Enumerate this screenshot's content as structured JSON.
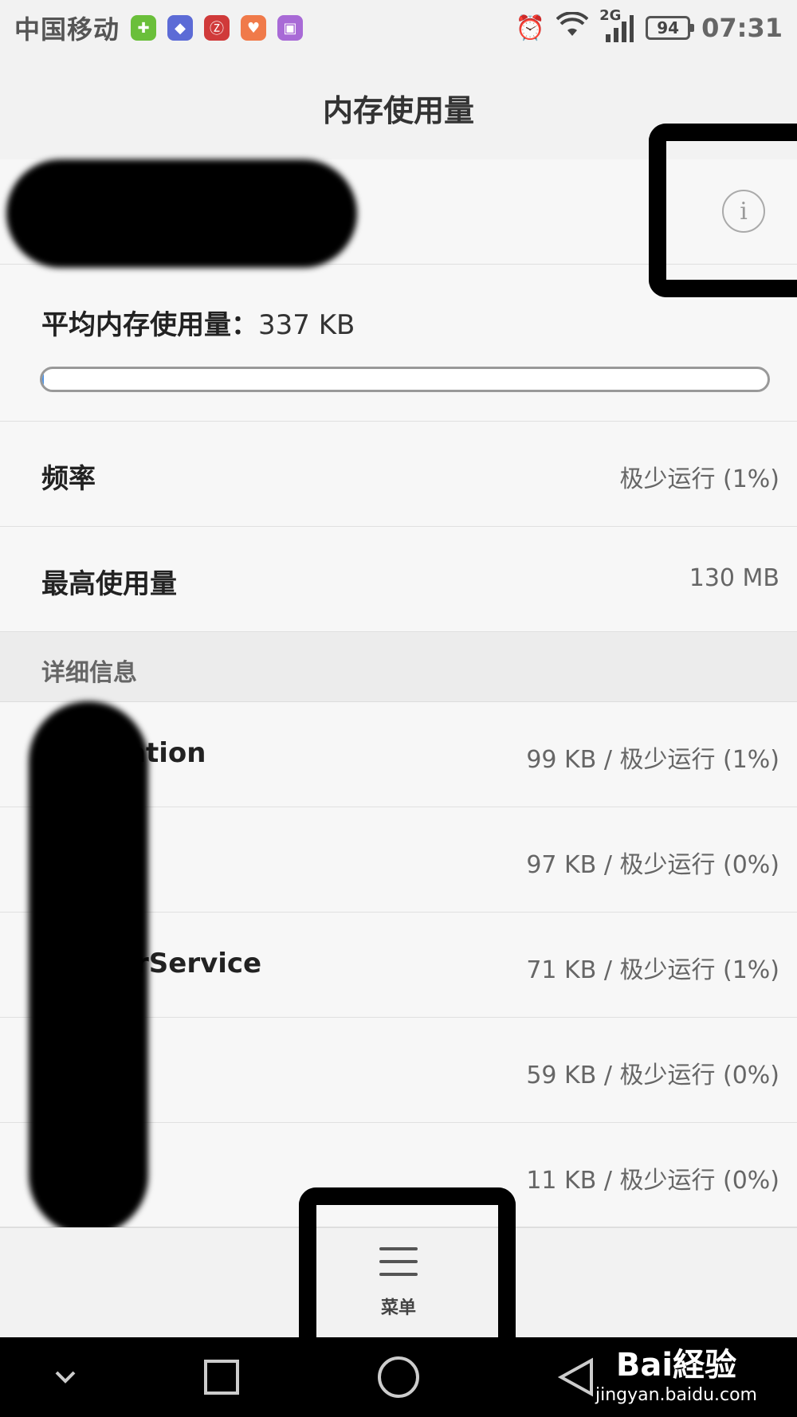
{
  "status_bar": {
    "carrier": "中国移动",
    "network": "2G",
    "battery": "94",
    "time": "07:31"
  },
  "title": "内存使用量",
  "average": {
    "label": "平均内存使用量：",
    "value": "337 KB",
    "progress_fraction": 0.002
  },
  "frequency": {
    "label": "频率",
    "value": "极少运行 (1%)"
  },
  "peak": {
    "label": "最高使用量",
    "value": "130 MB"
  },
  "details": {
    "header": "详细信息",
    "items": [
      {
        "name": "ation",
        "value": "99 KB / 极少运行 (1%)"
      },
      {
        "name": "",
        "value": "97 KB / 极少运行 (0%)"
      },
      {
        "name": "rService",
        "value": "71 KB / 极少运行 (1%)"
      },
      {
        "name": "",
        "value": "59 KB / 极少运行 (0%)"
      },
      {
        "name": "",
        "value": "11 KB / 极少运行 (0%)"
      }
    ]
  },
  "bottom_menu": {
    "label": "菜单"
  },
  "watermark": {
    "logo": "Bai経验",
    "url": "jingyan.baidu.com"
  },
  "colors": {
    "accent": "#4a90e2",
    "background": "#f7f7f7"
  }
}
